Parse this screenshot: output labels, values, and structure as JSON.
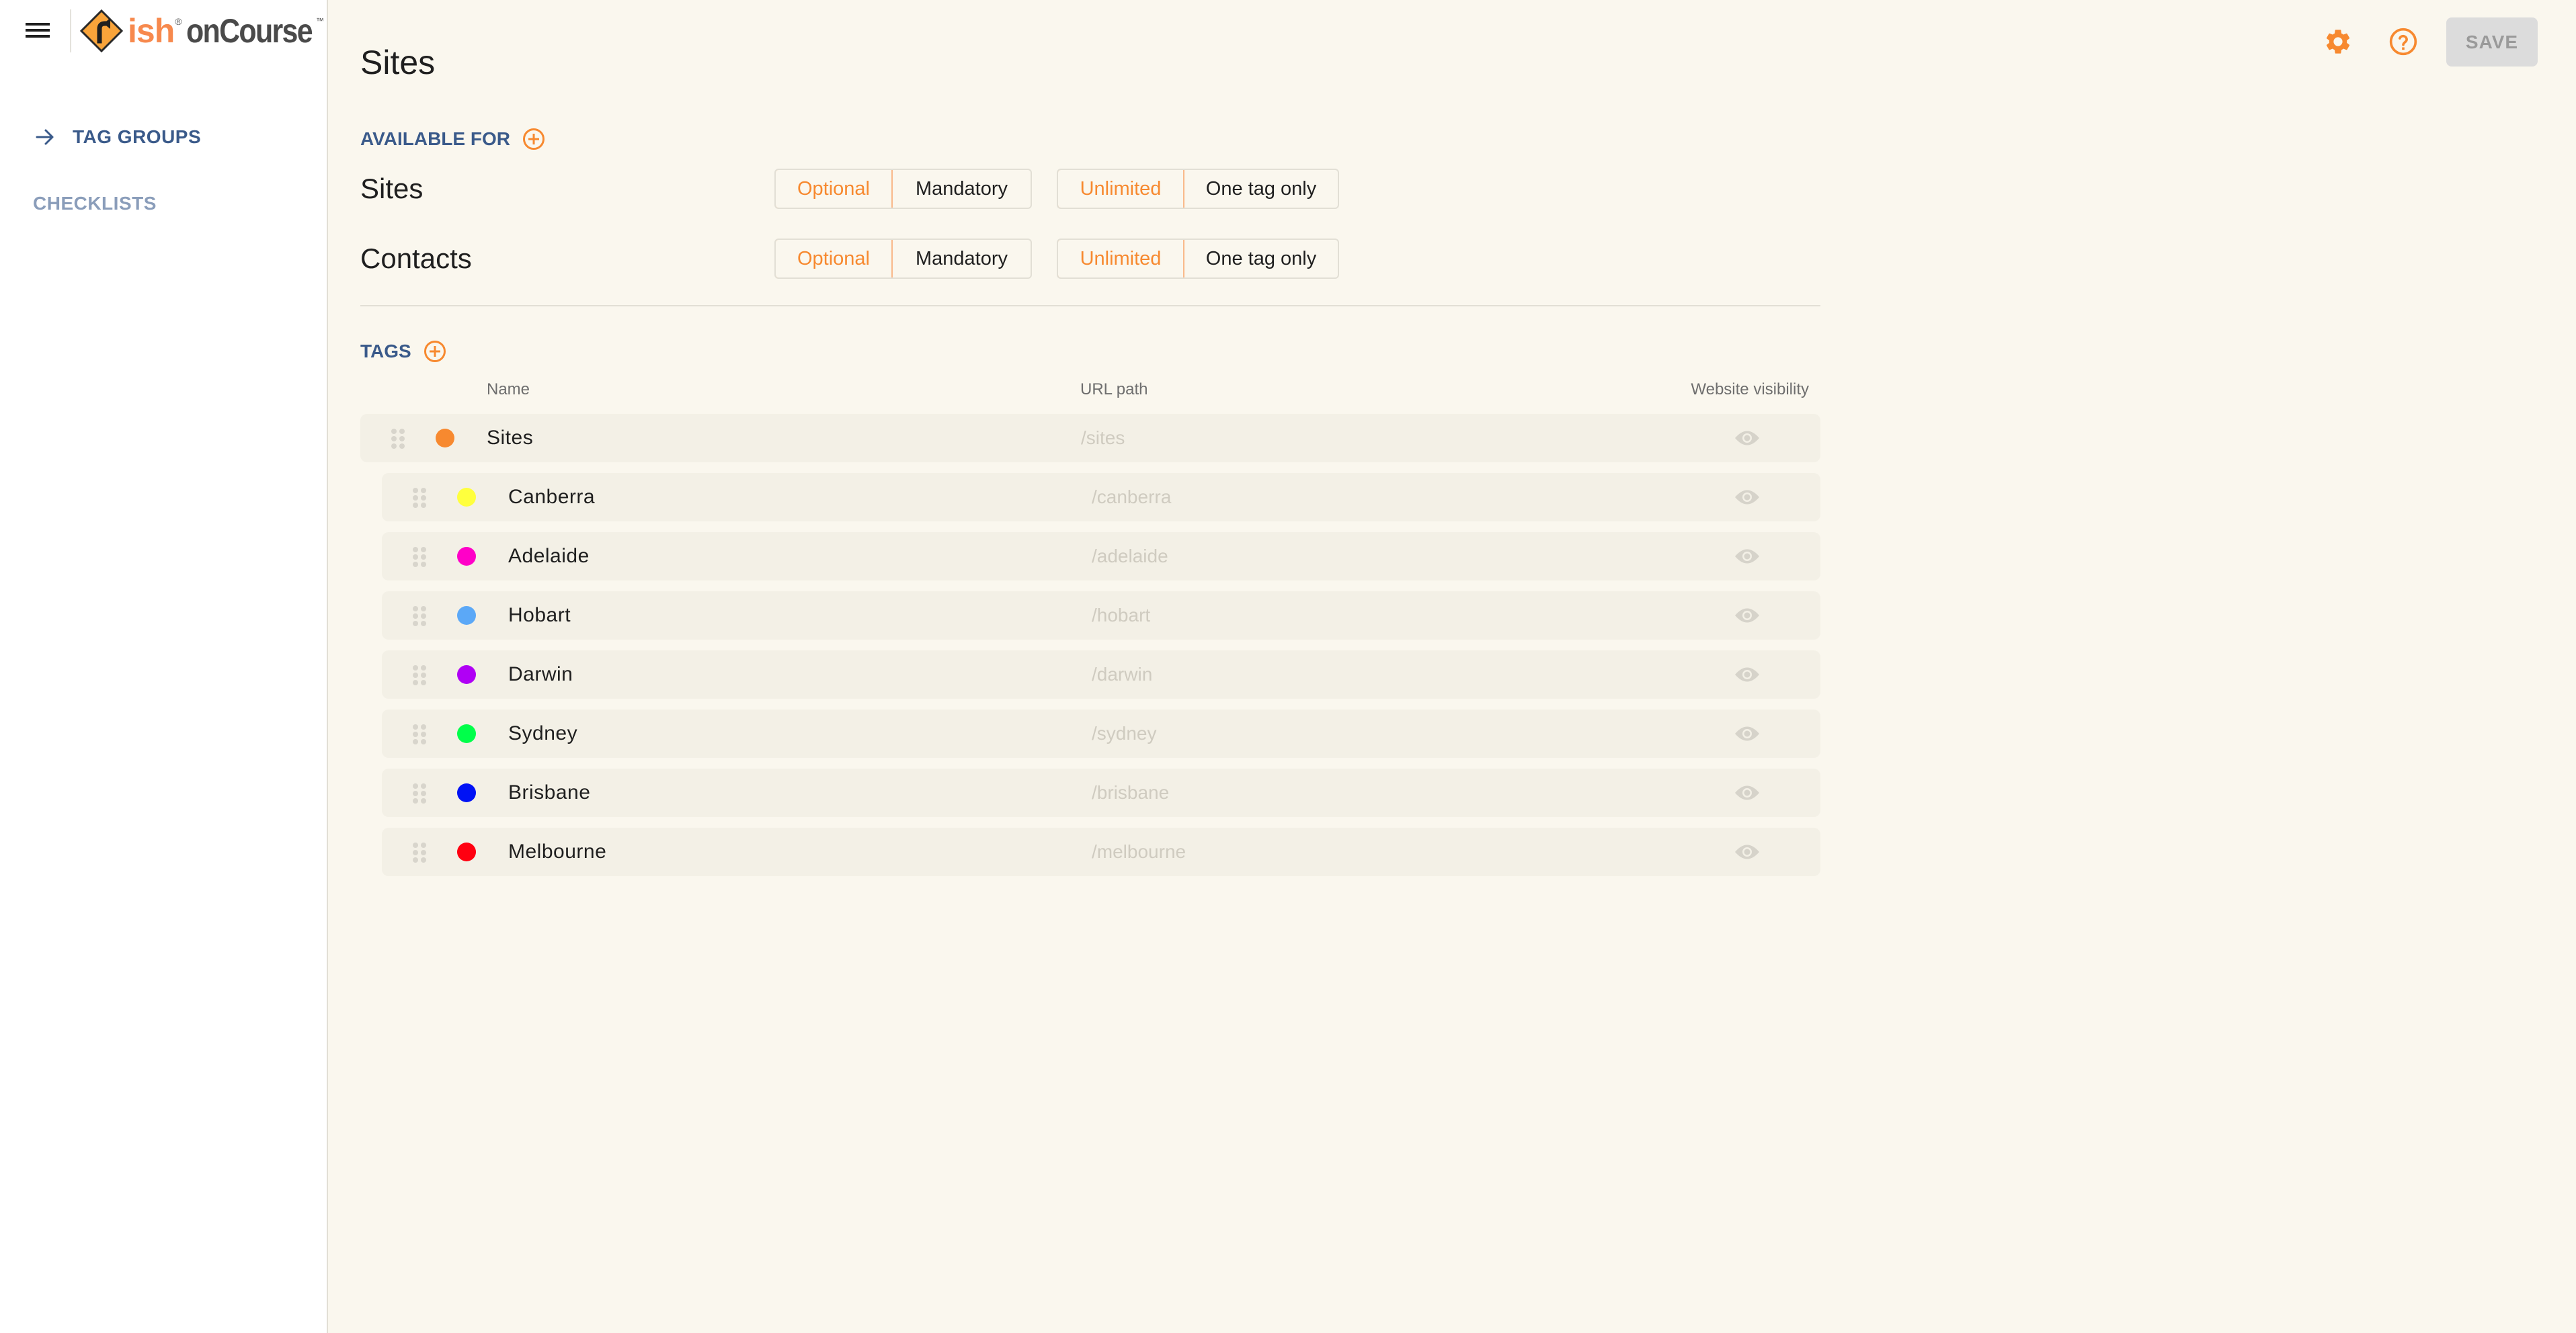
{
  "app": {
    "logo_brand": "ish",
    "logo_registered": "®",
    "logo_product": "onCourse",
    "logo_trademark": "™"
  },
  "sidebar": {
    "items": [
      {
        "label": "TAG GROUPS",
        "active": true,
        "icon": "arrow-right-icon"
      },
      {
        "label": "CHECKLISTS",
        "active": false
      }
    ]
  },
  "toolbar": {
    "settings_icon": "gear-icon",
    "help_icon": "help-circle-icon",
    "save_label": "SAVE",
    "save_enabled": false
  },
  "page": {
    "title": "Sites"
  },
  "available_for": {
    "heading": "AVAILABLE FOR",
    "entities": [
      {
        "label": "Sites",
        "requirement_options": [
          "Optional",
          "Mandatory"
        ],
        "requirement_selected": "Optional",
        "limit_options": [
          "Unlimited",
          "One tag only"
        ],
        "limit_selected": "Unlimited"
      },
      {
        "label": "Contacts",
        "requirement_options": [
          "Optional",
          "Mandatory"
        ],
        "requirement_selected": "Optional",
        "limit_options": [
          "Unlimited",
          "One tag only"
        ],
        "limit_selected": "Unlimited"
      }
    ]
  },
  "tags": {
    "heading": "TAGS",
    "columns": {
      "name": "Name",
      "url": "URL path",
      "visibility": "Website visibility"
    },
    "root": {
      "name": "Sites",
      "url": "/sites",
      "color": "#F7892F",
      "visible": true
    },
    "children": [
      {
        "name": "Canberra",
        "url": "/canberra",
        "color": "#FFFF3D",
        "visible": true
      },
      {
        "name": "Adelaide",
        "url": "/adelaide",
        "color": "#FF00C8",
        "visible": true
      },
      {
        "name": "Hobart",
        "url": "/hobart",
        "color": "#5BA8F7",
        "visible": true
      },
      {
        "name": "Darwin",
        "url": "/darwin",
        "color": "#B000F5",
        "visible": true
      },
      {
        "name": "Sydney",
        "url": "/sydney",
        "color": "#00FF4A",
        "visible": true
      },
      {
        "name": "Brisbane",
        "url": "/brisbane",
        "color": "#0012F5",
        "visible": true
      },
      {
        "name": "Melbourne",
        "url": "/melbourne",
        "color": "#FF0010",
        "visible": true
      }
    ]
  },
  "colors": {
    "accent": "#F7892F",
    "nav_active": "#3A5A8A",
    "nav_inactive": "#8A9DBA",
    "background": "#FAF7EE",
    "row_background": "#F3F0E6"
  }
}
